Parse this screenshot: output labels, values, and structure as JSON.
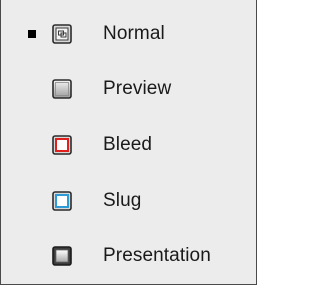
{
  "menu": {
    "items": [
      {
        "label": "Normal",
        "icon": "normal-mode-icon",
        "checked": true
      },
      {
        "label": "Preview",
        "icon": "preview-mode-icon",
        "checked": false
      },
      {
        "label": "Bleed",
        "icon": "bleed-mode-icon",
        "checked": false
      },
      {
        "label": "Slug",
        "icon": "slug-mode-icon",
        "checked": false
      },
      {
        "label": "Presentation",
        "icon": "presentation-mode-icon",
        "checked": false
      }
    ]
  },
  "colors": {
    "bleed_accent": "#e0201c",
    "slug_accent": "#2e9ad6"
  }
}
